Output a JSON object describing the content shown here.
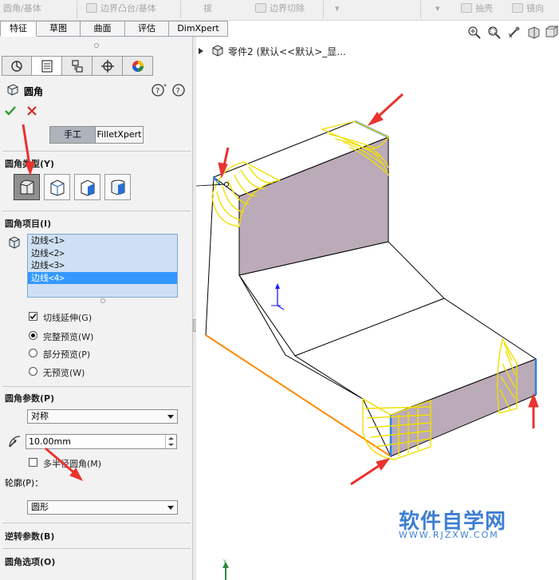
{
  "toolbar": {
    "items": [
      "圆角/基体",
      "边界凸台/基体",
      "拔",
      "边界切除",
      "抽壳",
      "镜向"
    ]
  },
  "tabs": [
    {
      "label": "特征",
      "active": true
    },
    {
      "label": "草图",
      "active": false
    },
    {
      "label": "曲面",
      "active": false
    },
    {
      "label": "评估",
      "active": false
    },
    {
      "label": "DimXpert",
      "active": false
    }
  ],
  "tree": {
    "label": "零件2  (默认<<默认>_显..."
  },
  "property_manager": {
    "title": "圆角",
    "mode_buttons": {
      "manual": "手工",
      "filletxpert": "FilletXpert"
    },
    "fillet_type": {
      "title": "圆角类型(Y)"
    },
    "fillet_items": {
      "title": "圆角项目(I)",
      "edges": [
        "边线<1>",
        "边线<2>",
        "边线<3>",
        "边线<4>"
      ],
      "selected_index": 3,
      "tangent_propagation": "切线延伸(G)",
      "previews": [
        "完整预览(W)",
        "部分预览(P)",
        "无预览(W)"
      ],
      "preview_selected": 0
    },
    "fillet_params": {
      "title": "圆角参数(P)",
      "method": "对称",
      "radius": "10.00mm",
      "multi_radius": "多半径圆角(M)",
      "profile_label": "轮廓(P)：",
      "profile": "圆形"
    },
    "reverse_params": {
      "title": "逆转参数(B)"
    },
    "fillet_options": {
      "title": "圆角选项(O)"
    }
  },
  "watermark": {
    "text": "软件自学网",
    "url": "WWW.RJZXW.COM"
  },
  "colors": {
    "accent_arrow": "#e8332e",
    "fillet_preview": "#f0e000",
    "part_face_shaded": "#bbaab8",
    "selected_edge": "#2f7fe0",
    "list_highlight": "#3399ff"
  }
}
